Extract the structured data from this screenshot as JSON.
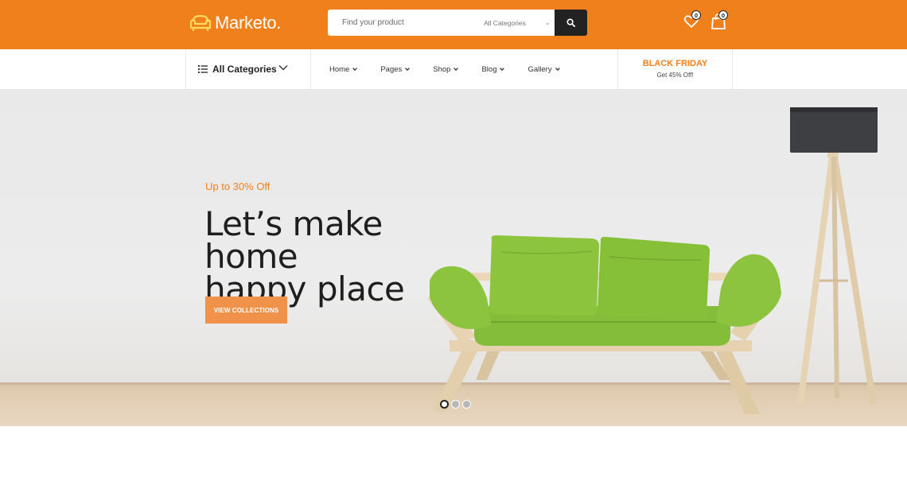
{
  "brand": {
    "name": "Marketo.",
    "color": "#f0801c"
  },
  "search": {
    "placeholder": "Find your product",
    "category_value": "All Categories",
    "icon": "search-icon"
  },
  "header_icons": {
    "wishlist": {
      "icon": "heart-icon",
      "count": "0"
    },
    "cart": {
      "icon": "shopping-bag-icon",
      "count": "0"
    }
  },
  "nav": {
    "categories_label": "All Categories",
    "items": [
      {
        "label": "Home"
      },
      {
        "label": "Pages"
      },
      {
        "label": "Shop"
      },
      {
        "label": "Blog"
      },
      {
        "label": "Gallery"
      }
    ],
    "promo": {
      "title": "BLACK FRIDAY",
      "subtitle": "Get 45% Off!"
    }
  },
  "hero": {
    "kicker": "Up to 30% Off",
    "title_line1": "Let’s make home",
    "title_line2": "happy place",
    "button_label": "VIEW COLLECTIONS",
    "slides": {
      "count": 3,
      "active": 1
    }
  }
}
